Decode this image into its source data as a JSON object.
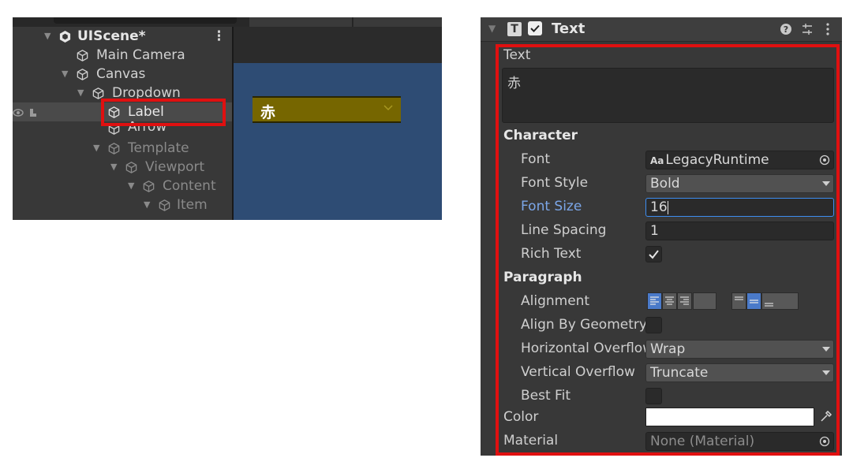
{
  "hierarchy": {
    "scene": {
      "name": "UIScene*",
      "menu_icon": "kebab-menu-icon"
    },
    "items": [
      {
        "label": "Main Camera",
        "icon": "gameobject-cube-icon"
      },
      {
        "label": "Canvas",
        "icon": "gameobject-cube-icon"
      },
      {
        "label": "Dropdown",
        "icon": "gameobject-cube-icon"
      },
      {
        "label": "Label",
        "icon": "gameobject-cube-icon",
        "selected": true
      },
      {
        "label": "Arrow",
        "icon": "gameobject-cube-icon"
      },
      {
        "label": "Template",
        "icon": "gameobject-cube-icon",
        "inactive": true
      },
      {
        "label": "Viewport",
        "icon": "gameobject-cube-icon",
        "inactive": true
      },
      {
        "label": "Content",
        "icon": "gameobject-cube-icon",
        "inactive": true
      },
      {
        "label": "Item",
        "icon": "gameobject-cube-icon",
        "inactive": true
      }
    ]
  },
  "game_view": {
    "dropdown_text": "赤",
    "background_color": "#2e4c74",
    "dropdown_color": "#766600"
  },
  "inspector": {
    "component": {
      "title": "Text",
      "enabled": true,
      "icon": "text-component-icon"
    },
    "text_section": {
      "label": "Text",
      "value": "赤"
    },
    "character": {
      "header": "Character",
      "font": {
        "label": "Font",
        "value": "LegacyRuntime",
        "prefix": "Aa"
      },
      "font_style": {
        "label": "Font Style",
        "value": "Bold"
      },
      "font_size": {
        "label": "Font Size",
        "value": "16"
      },
      "line_spacing": {
        "label": "Line Spacing",
        "value": "1"
      },
      "rich_text": {
        "label": "Rich Text",
        "checked": true
      }
    },
    "paragraph": {
      "header": "Paragraph",
      "alignment": {
        "label": "Alignment",
        "horizontal": "left",
        "vertical": "middle"
      },
      "align_by_geometry": {
        "label": "Align By Geometry",
        "checked": false
      },
      "horizontal_overflow": {
        "label": "Horizontal Overflow",
        "value": "Wrap"
      },
      "vertical_overflow": {
        "label": "Vertical Overflow",
        "value": "Truncate"
      },
      "best_fit": {
        "label": "Best Fit",
        "checked": false
      }
    },
    "color": {
      "label": "Color",
      "value": "#ffffff"
    },
    "material": {
      "label": "Material",
      "value": "None (Material)"
    }
  },
  "highlight_color": "#e01010"
}
